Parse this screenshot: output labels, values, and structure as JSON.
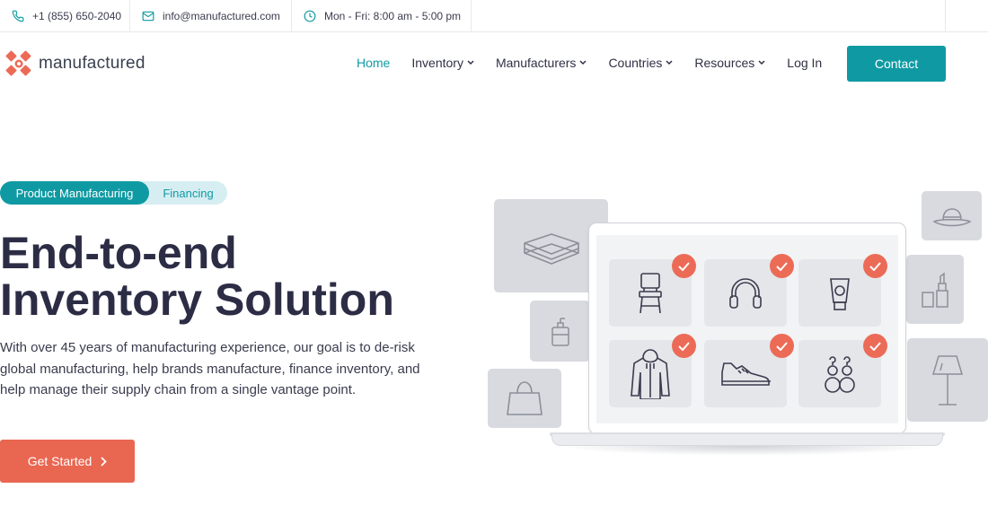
{
  "topbar": {
    "phone": "+1 (855) 650-2040",
    "email": "info@manufactured.com",
    "hours": "Mon - Fri: 8:00 am - 5:00 pm"
  },
  "brand": {
    "name": "manufactured",
    "accent": "#0f9aa3",
    "logo_color": "#ec6b57"
  },
  "nav": {
    "items": [
      {
        "label": "Home",
        "active": true
      },
      {
        "label": "Inventory",
        "dropdown": true
      },
      {
        "label": "Manufacturers",
        "dropdown": true
      },
      {
        "label": "Countries",
        "dropdown": true
      },
      {
        "label": "Resources",
        "dropdown": true
      },
      {
        "label": "Log In"
      }
    ],
    "contact_label": "Contact"
  },
  "hero": {
    "tabs": [
      "Product Manufacturing",
      "Financing"
    ],
    "headline_line1": "End-to-end",
    "headline_line2": "Inventory Solution",
    "lead_line1": "With over 45 years of manufacturing experience, our goal is to de-risk",
    "lead_line2": "global manufacturing, help brands manufacture, finance inventory, and",
    "lead_line3": "help manage their supply chain from a single vantage point.",
    "cta_label": "Get Started",
    "cta_color": "#e96651"
  },
  "illustration": {
    "products": [
      "chair-icon",
      "headphones-icon",
      "lotion-icon",
      "hoodie-icon",
      "sneaker-icon",
      "earrings-icon"
    ],
    "side_items": [
      "towels-icon",
      "soap-bottle-icon",
      "handbag-icon",
      "hat-icon",
      "cosmetics-icon",
      "floor-lamp-icon"
    ]
  }
}
